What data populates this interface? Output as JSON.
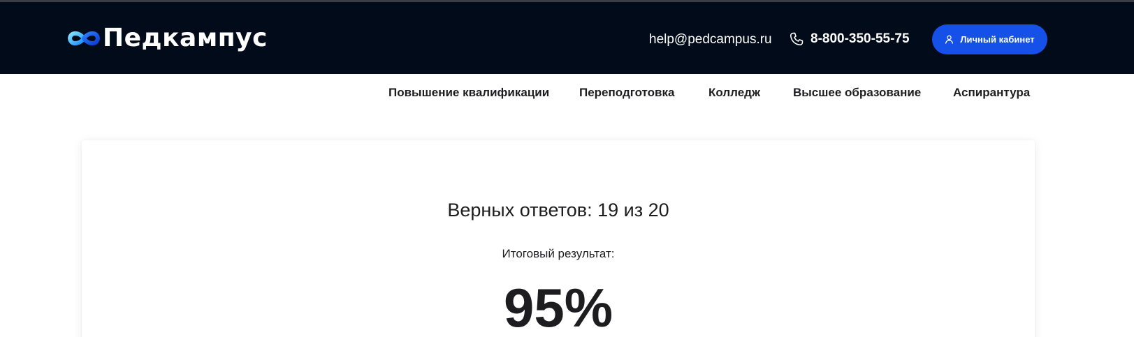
{
  "header": {
    "logo_text": "Педкампус",
    "email": "help@pedcampus.ru",
    "phone": "8-800-350-55-75",
    "cabinet_button": "Личный кабинет",
    "icons": {
      "logo": "infinity-logo-icon",
      "phone": "phone-icon",
      "user": "user-icon"
    },
    "colors": {
      "background": "#020b1a",
      "button": "#1550e8"
    }
  },
  "nav": {
    "items": [
      {
        "label": "Повышение квалификации"
      },
      {
        "label": "Переподготовка"
      },
      {
        "label": "Колледж"
      },
      {
        "label": "Высшее образование"
      },
      {
        "label": "Аспирантура"
      }
    ]
  },
  "result": {
    "answers_text": "Верных ответов: 19 из 20",
    "final_label": "Итоговый результат:",
    "percent": "95%"
  }
}
